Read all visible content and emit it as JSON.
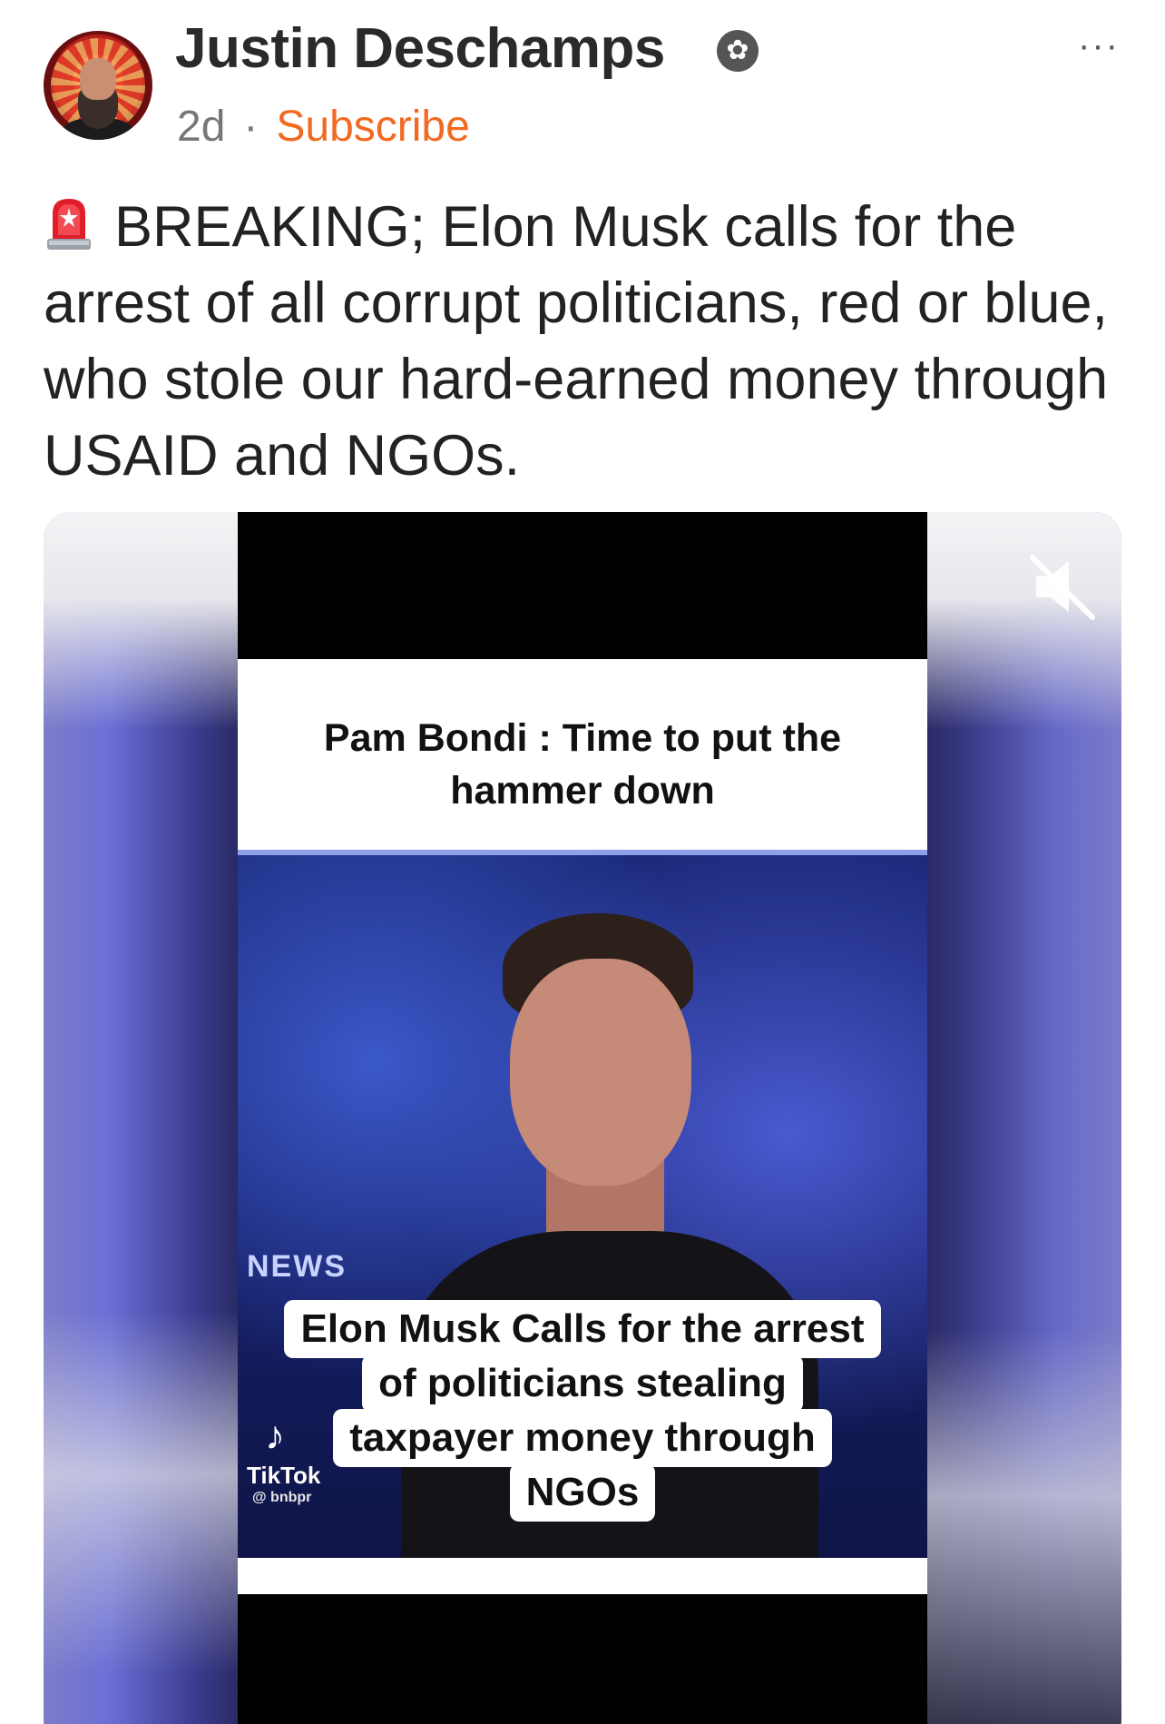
{
  "author": {
    "name": "Justin Deschamps",
    "badge_icon": "verified-badge-icon",
    "time": "2d",
    "separator": "·",
    "subscribe_label": "Subscribe",
    "subscribe_color": "#f26a21"
  },
  "menu": {
    "more_label": "···"
  },
  "post": {
    "emoji_icon": "siren-icon",
    "text": "BREAKING; Elon Musk calls for the arrest of all corrupt politicians, red or blue, who stole our hard-earned money through USAID and NGOs."
  },
  "video": {
    "headline": "Pam Bondi : Time to put the hammer down",
    "tiktok_label": "TikTok",
    "tiktok_handle": "@ bnbpr",
    "news_text": "NEWS",
    "caption_lines": [
      "Elon Musk Calls for the arrest",
      "of politicians stealing",
      "taxpayer money through",
      "NGOs"
    ],
    "mute_icon": "speaker-muted-icon"
  }
}
